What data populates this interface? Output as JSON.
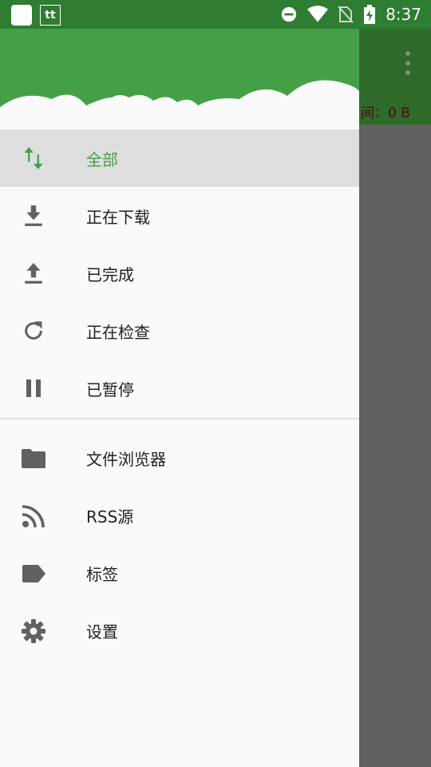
{
  "status_bar": {
    "app_icon_1": "app-square-icon",
    "app_icon_2": "tt",
    "time": "8:37",
    "icons": [
      "dnd-icon",
      "wifi-icon",
      "no-sim-icon",
      "battery-charging-icon"
    ]
  },
  "background_app": {
    "free_space_text": "间：0 B",
    "overflow_icon": "more-vert-icon"
  },
  "drawer": {
    "header_color": "#43A047",
    "filters": [
      {
        "label": "全部",
        "icon": "swap-vert-icon",
        "active": true
      },
      {
        "label": "正在下载",
        "icon": "download-icon"
      },
      {
        "label": "已完成",
        "icon": "upload-icon"
      },
      {
        "label": "正在检查",
        "icon": "refresh-icon"
      },
      {
        "label": "已暂停",
        "icon": "pause-icon"
      }
    ],
    "links": [
      {
        "label": "文件浏览器",
        "icon": "folder-icon"
      },
      {
        "label": "RSS源",
        "icon": "rss-icon"
      },
      {
        "label": "标签",
        "icon": "label-icon"
      },
      {
        "label": "设置",
        "icon": "settings-icon"
      }
    ]
  },
  "colors": {
    "accent": "#43A047",
    "status_bar": "#2E7D32",
    "icon": "#616161"
  }
}
